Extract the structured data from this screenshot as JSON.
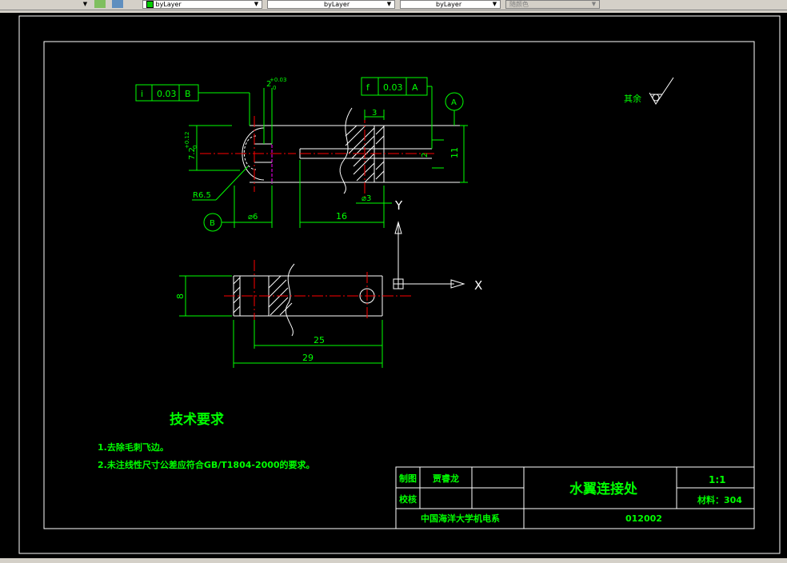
{
  "toolbar": {
    "layer_color": "byLayer",
    "linetype": "byLayer",
    "lineweight": "byLayer",
    "plot_style": "随颜色"
  },
  "drawing": {
    "tolerance_frame_1": {
      "symbol": "i",
      "value": "0.03",
      "datum": "B"
    },
    "tolerance_frame_2": {
      "symbol": "f",
      "value": "0.03",
      "datum": "A"
    },
    "datum_a": "A",
    "datum_b": "B",
    "dim_keyway_width": "2",
    "dim_keyway_tol": "+0.03",
    "dim_keyway_tol2": "0",
    "dim_depth": "7.2",
    "dim_depth_tol": "+0.12",
    "dim_depth_tol2": "0",
    "dim_radius": "R6.5",
    "dim_dia6": "⌀6",
    "dim_16": "16",
    "dim_3": "3",
    "dim_dia3": "⌀3",
    "dim_2": "2",
    "dim_11": "11",
    "dim_8": "8",
    "dim_25": "25",
    "dim_29": "29",
    "surface_note": "其余",
    "ucs_x": "X",
    "ucs_y": "Y"
  },
  "notes": {
    "heading": "技术要求",
    "line1": "1.去除毛刺飞边。",
    "line2": "2.未注线性尺寸公差应符合GB/T1804-2000的要求。"
  },
  "title_block": {
    "drawn_label": "制图",
    "drawn_by": "贾睿龙",
    "check_label": "校核",
    "part_name": "水翼连接处",
    "scale": "1:1",
    "material": "材料：304",
    "school": "中国海洋大学机电系",
    "drawing_no": "012002"
  },
  "colors": {
    "green": "#00ff00",
    "white": "#ffffff",
    "red": "#ff0000",
    "magenta": "#ff00ff",
    "background": "#000000"
  }
}
